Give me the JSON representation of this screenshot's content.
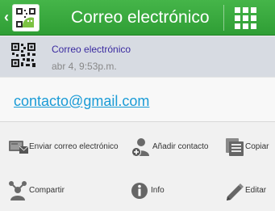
{
  "appbar": {
    "title": "Correo electrónico",
    "back_icon": "chevron-left-icon",
    "app_icon": "qr-droid-app-icon",
    "menu_icon": "grid-menu-icon",
    "color": "#3aa93f"
  },
  "record": {
    "type_label": "Correo electrónico",
    "timestamp": "abr 4, 9:53p.m.",
    "icon": "qr-code-icon"
  },
  "content": {
    "email": "contacto@gmail.com",
    "link_color": "#1a9bd6"
  },
  "actions": [
    {
      "label": "Enviar correo electrónico",
      "icon": "send-email-icon"
    },
    {
      "label": "Añadir contacto",
      "icon": "add-contact-icon"
    },
    {
      "label": "Copiar",
      "icon": "copy-icon"
    },
    {
      "label": "Compartir",
      "icon": "share-icon"
    },
    {
      "label": "Info",
      "icon": "info-icon"
    },
    {
      "label": "Editar",
      "icon": "edit-icon"
    }
  ]
}
